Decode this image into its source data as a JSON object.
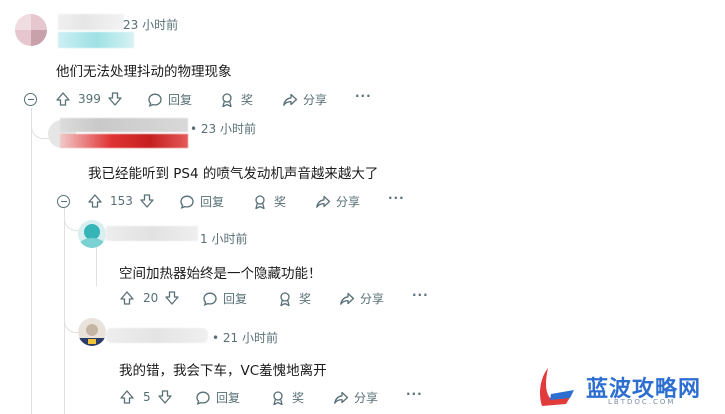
{
  "comments": [
    {
      "time": "23 小时前",
      "text": "他们无法处理抖动的物理现象",
      "votes": "399",
      "reply_label": "回复",
      "award_label": "奖",
      "share_label": "分享",
      "more_label": "···"
    },
    {
      "time": "• 23 小时前",
      "text": "我已经能听到 PS4 的喷气发动机声音越来越大了",
      "votes": "153",
      "reply_label": "回复",
      "award_label": "奖",
      "share_label": "分享",
      "more_label": "···"
    },
    {
      "time": "1 小时前",
      "text": "空间加热器始终是一个隐藏功能！",
      "votes": "20",
      "reply_label": "回复",
      "award_label": "奖",
      "share_label": "分享",
      "more_label": "···"
    },
    {
      "time": "• 21 小时前",
      "text": "我的错，我会下车，VC羞愧地离开",
      "votes": "5",
      "reply_label": "回复",
      "award_label": "奖",
      "share_label": "分享",
      "more_label": "···"
    }
  ],
  "watermark": {
    "title": "蓝波攻略网",
    "subtitle": "LBTDOC.COM"
  },
  "colors": {
    "meta": "#576f76",
    "thread": "#e0e0e0",
    "watermark_blue": "#2d6fd1"
  },
  "icons": [
    "upvote-icon",
    "downvote-icon",
    "comment-bubble-icon",
    "award-icon",
    "share-icon",
    "collapse-icon"
  ]
}
